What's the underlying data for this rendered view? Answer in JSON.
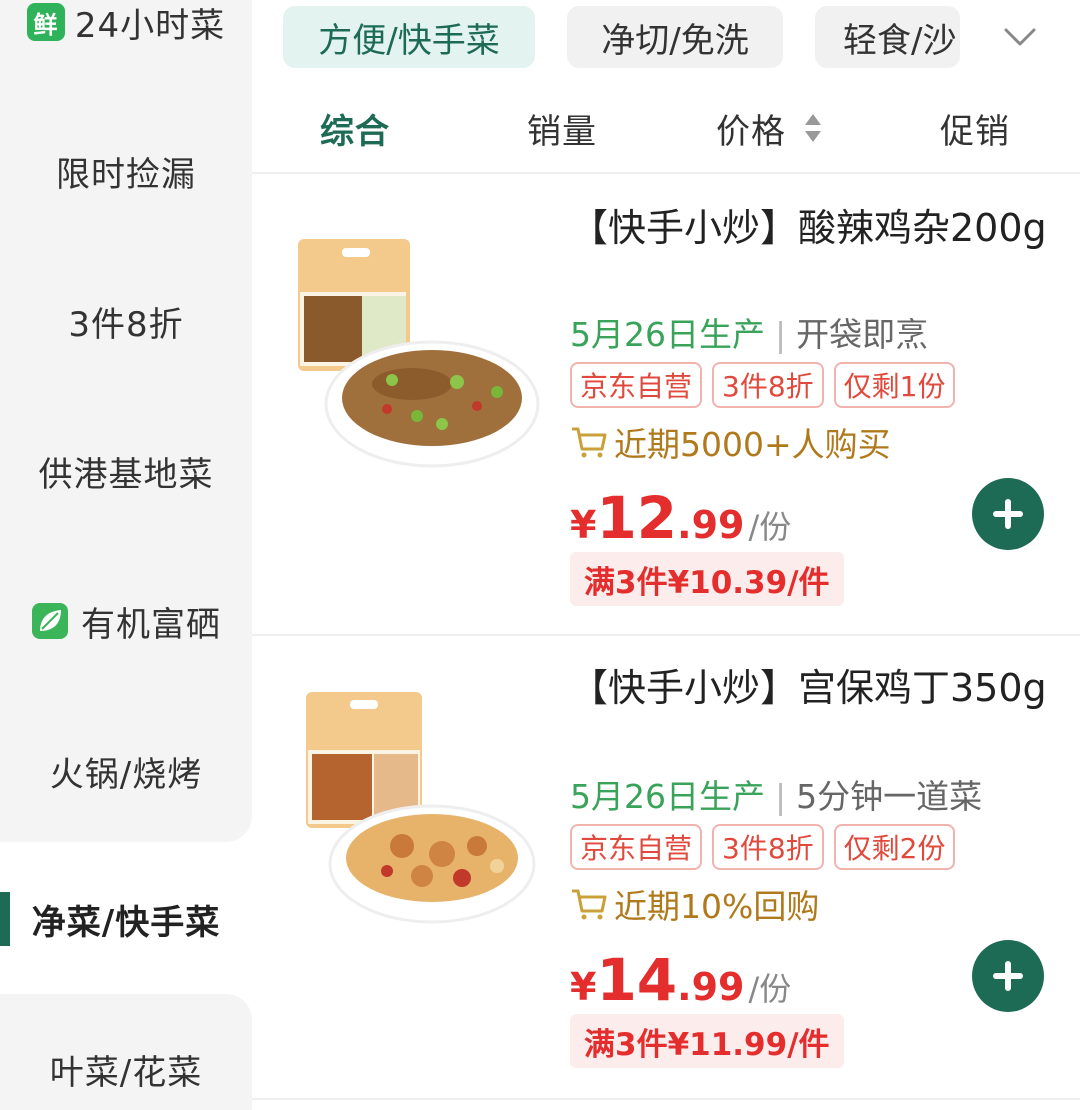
{
  "colors": {
    "accent": "#1e6b55",
    "price": "#e42d2d",
    "date_green": "#3aa35a",
    "tag_red": "#e0493b"
  },
  "sidebar": {
    "items": [
      {
        "label": "24小时菜",
        "badge": "鲜"
      },
      {
        "label": "限时捡漏"
      },
      {
        "label": "3件8折"
      },
      {
        "label": "供港基地菜"
      },
      {
        "label": "有机富硒",
        "icon": "leaf-icon"
      },
      {
        "label": "火锅/烧烤"
      },
      {
        "label": "净菜/快手菜",
        "active": true
      },
      {
        "label": "叶菜/花菜"
      }
    ]
  },
  "categories": {
    "chips": [
      {
        "label": "方便/快手菜",
        "active": true
      },
      {
        "label": "净切/免洗"
      },
      {
        "label": "轻食/沙"
      }
    ],
    "expand_icon": "chevron-down-icon"
  },
  "sort": {
    "items": [
      {
        "label": "综合",
        "active": true
      },
      {
        "label": "销量"
      },
      {
        "label": "价格",
        "icon": "sort-arrows-icon"
      },
      {
        "label": "促销"
      }
    ]
  },
  "products": [
    {
      "title": "【快手小炒】酸辣鸡杂200g",
      "date": "5月26日生产",
      "desc": "开袋即烹",
      "tags": [
        "京东自营",
        "3件8折",
        "仅剩1份"
      ],
      "buy_info": "近期5000+人购买",
      "price_currency": "¥",
      "price_int": "12",
      "price_dec": ".99",
      "price_unit": "/份",
      "promo": "满3件¥10.39/件"
    },
    {
      "title": "【快手小炒】宫保鸡丁350g",
      "date": "5月26日生产",
      "desc": "5分钟一道菜",
      "tags": [
        "京东自营",
        "3件8折",
        "仅剩2份"
      ],
      "buy_info": "近期10%回购",
      "price_currency": "¥",
      "price_int": "14",
      "price_dec": ".99",
      "price_unit": "/份",
      "promo": "满3件¥11.99/件"
    }
  ]
}
